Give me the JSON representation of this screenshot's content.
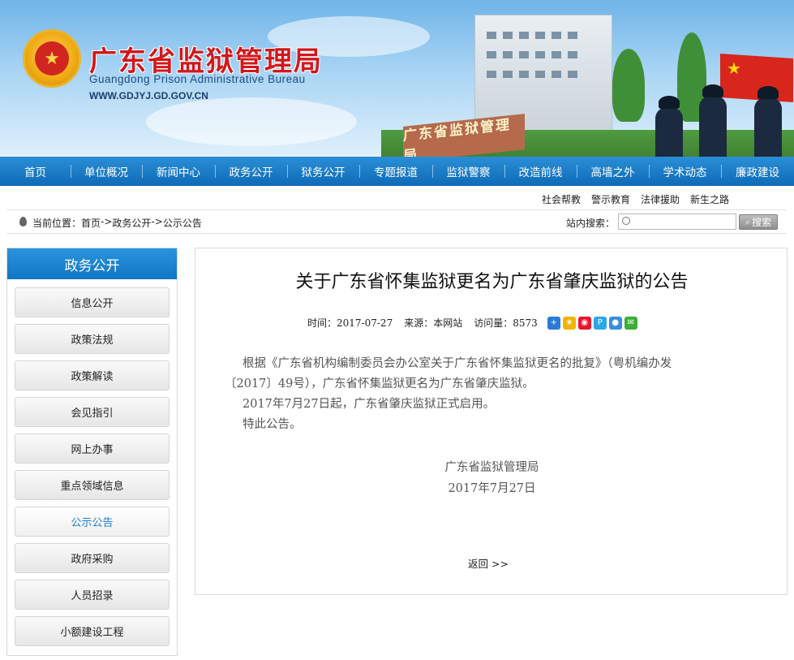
{
  "header": {
    "title": "广东省监狱管理局",
    "subtitle": "Guangdong Prison Administrative Bureau",
    "url": "WWW.GDJYJ.GD.GOV.CN",
    "wall_sign": "广东省监狱管理局",
    "emblem_icon": "police-emblem-icon"
  },
  "nav": {
    "items": [
      "首页",
      "单位概况",
      "新闻中心",
      "政务公开",
      "狱务公开",
      "专题报道",
      "监狱警察",
      "改造前线",
      "高墙之外",
      "学术动态",
      "廉政建设"
    ]
  },
  "sublinks": [
    "社会帮教",
    "警示教育",
    "法律援助",
    "新生之路"
  ],
  "breadcrumb": {
    "label": "当前位置：",
    "home": "首页",
    "sep1": " -> ",
    "section": "政务公开",
    "sep2": " -> ",
    "current": "公示公告"
  },
  "search": {
    "label": "站内搜索：",
    "value": "",
    "button": "搜索"
  },
  "sidebar": {
    "title": "政务公开",
    "items": [
      "信息公开",
      "政策法规",
      "政策解读",
      "会见指引",
      "网上办事",
      "重点领域信息",
      "公示公告",
      "政府采购",
      "人员招录",
      "小额建设工程"
    ],
    "active": "公示公告"
  },
  "article": {
    "title": "关于广东省怀集监狱更名为广东省肇庆监狱的公告",
    "meta": {
      "time_label": "时间：",
      "time": "2017-07-27",
      "source_label": "来源：",
      "source": "本网站",
      "views_label": "访问量：",
      "views": "8573"
    },
    "share_icons": [
      "plus-share-icon",
      "qzone-share-icon",
      "weibo-share-icon",
      "tencent-weibo-share-icon",
      "qq-share-icon",
      "wechat-share-icon"
    ],
    "paragraphs": [
      "根据《广东省机构编制委员会办公室关于广东省怀集监狱更名的批复》（粤机编办发",
      "〔2017〕49号），广东省怀集监狱更名为广东省肇庆监狱。",
      "2017年7月27日起，广东省肇庆监狱正式启用。",
      "特此公告。"
    ],
    "signature": "广东省监狱管理局",
    "date": "2017年7月27日",
    "back": "返回 >>"
  }
}
